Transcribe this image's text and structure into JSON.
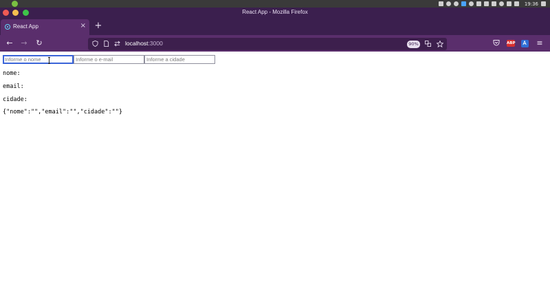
{
  "os": {
    "clock": "19:36",
    "tray_icons": [
      "network-icon",
      "notification-icon",
      "record-icon",
      "camera-icon",
      "dropbox-icon",
      "clipboard-icon",
      "volume-icon",
      "bluetooth-icon",
      "mic-icon",
      "wifi-icon",
      "menu-arrow-icon",
      "screen-icon"
    ]
  },
  "window": {
    "title": "React App - Mozilla Firefox"
  },
  "tabs": [
    {
      "label": "React App",
      "close": "×"
    }
  ],
  "newtab_label": "+",
  "navbar": {
    "back": "←",
    "forward": "→",
    "reload": "↻",
    "url_host": "localhost",
    "url_port": ":3000",
    "zoom": "90%",
    "abp_label": "ABP",
    "menu": "≡"
  },
  "form": {
    "nome_placeholder": "Informe o nome",
    "email_placeholder": "Informe o e-mail",
    "cidade_placeholder": "Informe a cidade"
  },
  "output": {
    "nome": "nome:",
    "email": "email:",
    "cidade": "cidade:",
    "json": "{\"nome\":\"\",\"email\":\"\",\"cidade\":\"\"}"
  },
  "colors": {
    "titlebar": "#3b1f4e",
    "toolbar": "#5a2e6c",
    "urlbar": "#3d1f4d",
    "focus": "#3a64d8"
  }
}
